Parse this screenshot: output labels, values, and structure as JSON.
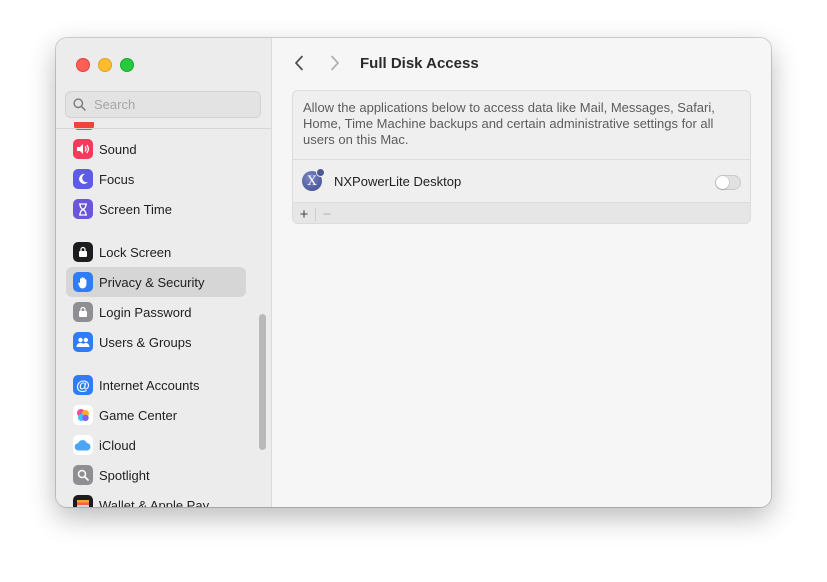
{
  "sidebar": {
    "search_placeholder": "Search",
    "items": [
      {
        "label": "Sound",
        "icon": "speaker-icon",
        "color": "#f43b5c"
      },
      {
        "label": "Focus",
        "icon": "moon-icon",
        "color": "#5e5ce6"
      },
      {
        "label": "Screen Time",
        "icon": "hourglass-icon",
        "color": "#6b56d8"
      },
      {
        "label": "Lock Screen",
        "icon": "lock-screen-icon",
        "color": "#1c1c1e"
      },
      {
        "label": "Privacy & Security",
        "icon": "hand-icon",
        "color": "#2f7cf6",
        "selected": true
      },
      {
        "label": "Login Password",
        "icon": "lock-icon",
        "color": "#8e8e93"
      },
      {
        "label": "Users & Groups",
        "icon": "users-icon",
        "color": "#2f7cf6"
      },
      {
        "label": "Internet Accounts",
        "icon": "at-icon",
        "color": "#2f7cf6"
      },
      {
        "label": "Game Center",
        "icon": "game-center-icon",
        "color": "#ffffff"
      },
      {
        "label": "iCloud",
        "icon": "cloud-icon",
        "color": "#ffffff"
      },
      {
        "label": "Spotlight",
        "icon": "magnifier-icon",
        "color": "#8e8e93"
      },
      {
        "label": "Wallet & Apple Pay",
        "icon": "wallet-icon",
        "color": "#1c1c1e"
      }
    ]
  },
  "main": {
    "title": "Full Disk Access",
    "description": "Allow the applications below to access data like Mail, Messages, Safari, Home, Time Machine backups and certain administrative settings for all users on this Mac.",
    "apps": [
      {
        "name": "NXPowerLite Desktop",
        "icon_glyph": "X",
        "enabled": false
      }
    ],
    "add_label": "+",
    "remove_label": "−"
  }
}
